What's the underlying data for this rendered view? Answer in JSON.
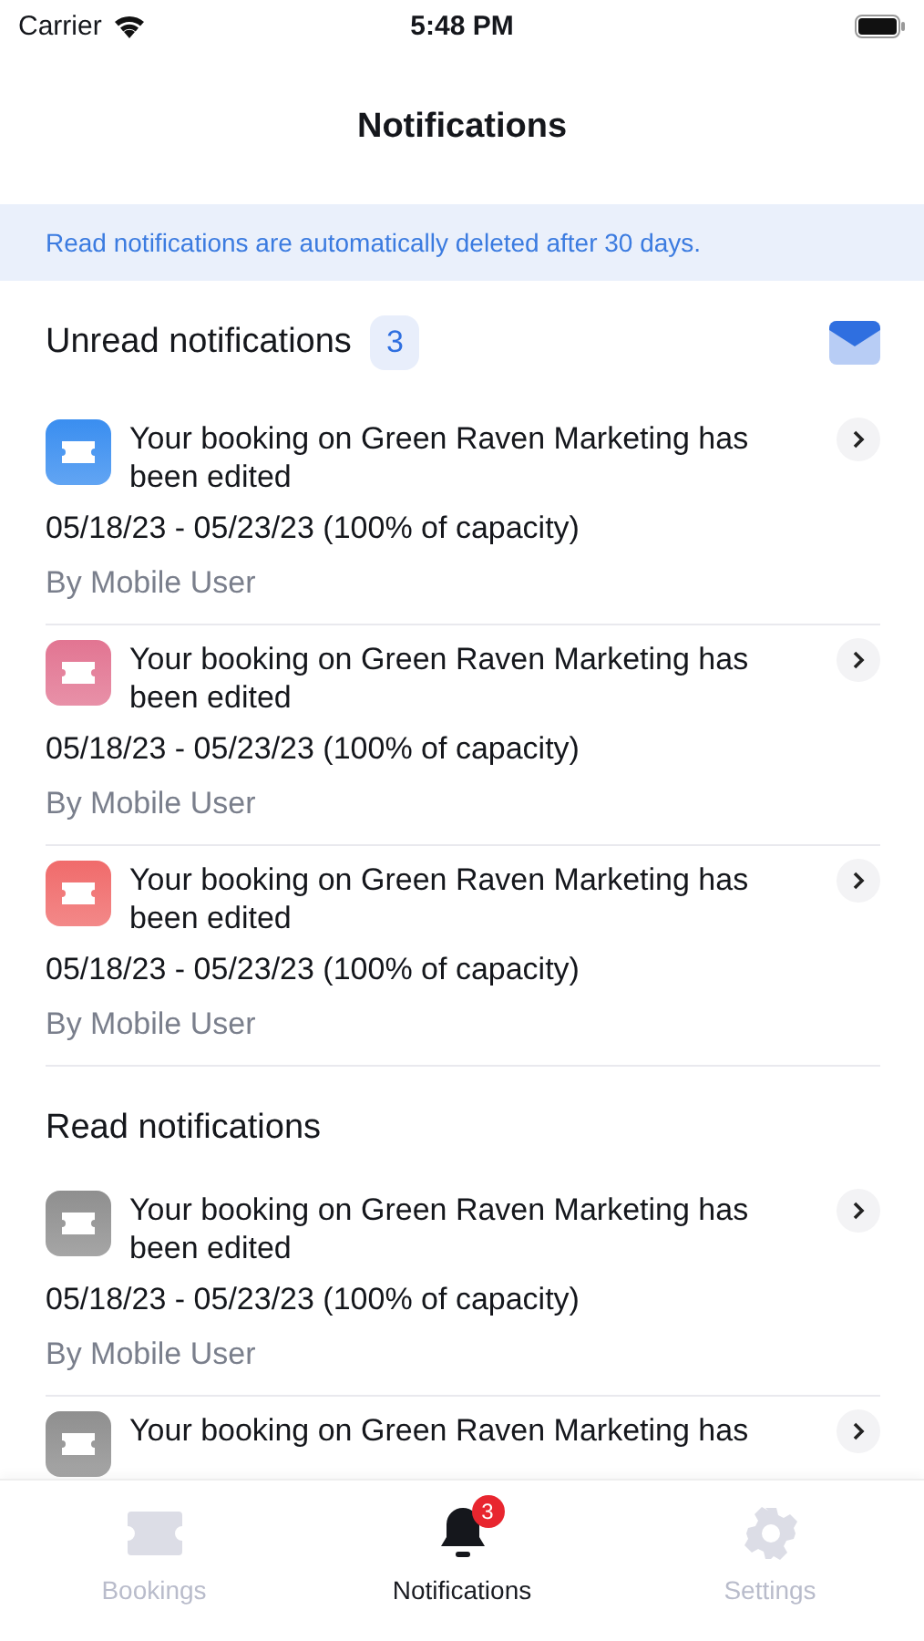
{
  "status_bar": {
    "carrier": "Carrier",
    "time": "5:48 PM"
  },
  "title": "Notifications",
  "banner": "Read notifications are automatically deleted after 30 days.",
  "sections": [
    {
      "title": "Unread notifications",
      "count": "3",
      "items": [
        {
          "title": "Your booking on Green Raven Marketing has been edited",
          "dates": "05/18/23 - 05/23/23 (100% of capacity)",
          "author": "By Mobile User",
          "color": "#3a8ef0"
        },
        {
          "title": "Your booking on Green Raven Marketing has been edited",
          "dates": "05/18/23 - 05/23/23 (100% of capacity)",
          "author": "By Mobile User",
          "color": "#e27592"
        },
        {
          "title": "Your booking on Green Raven Marketing has been edited",
          "dates": "05/18/23 - 05/23/23 (100% of capacity)",
          "author": "By Mobile User",
          "color": "#f06b6b"
        }
      ]
    },
    {
      "title": "Read notifications",
      "items": [
        {
          "title": "Your booking on Green Raven Marketing has been edited",
          "dates": "05/18/23 - 05/23/23 (100% of capacity)",
          "author": "By Mobile User",
          "color": "#8f8f8f"
        },
        {
          "title": "Your booking on Green Raven Marketing has",
          "color": "#8f8f8f"
        }
      ]
    }
  ],
  "tabs": [
    {
      "label": "Bookings",
      "kind": "ticket",
      "selected": false
    },
    {
      "label": "Notifications",
      "kind": "bell",
      "selected": true,
      "badge": "3"
    },
    {
      "label": "Settings",
      "kind": "gear",
      "selected": false
    }
  ]
}
